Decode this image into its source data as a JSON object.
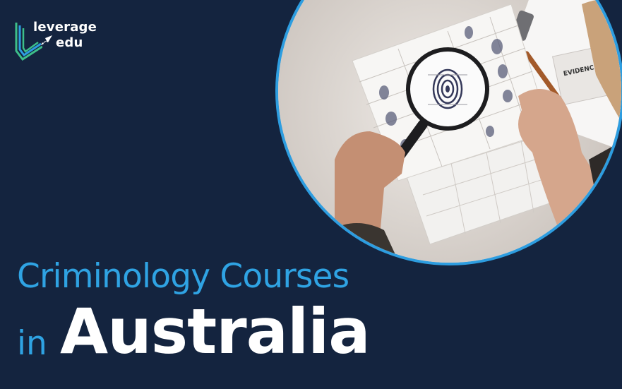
{
  "brand": {
    "line1": "leverage",
    "line2": "edu",
    "colors": {
      "green": "#3dbf8a",
      "blue": "#2d9de0"
    }
  },
  "headline": {
    "line1": "Criminology Courses",
    "prefix": "in",
    "line2": "Australia"
  },
  "photo": {
    "evidence_label": "EVIDENCE",
    "icons": [
      "magnifying-glass-icon",
      "fingerprint-card"
    ]
  },
  "colors": {
    "background": "#14243f",
    "accent": "#2fa3e3",
    "text": "#ffffff",
    "ring": "#2d9de0"
  }
}
